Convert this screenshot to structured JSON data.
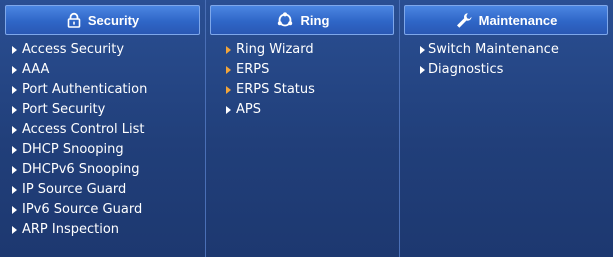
{
  "menu": {
    "security": {
      "title": "Security",
      "icon": "lock-icon",
      "items": [
        "Access Security",
        "AAA",
        "Port Authentication",
        "Port Security",
        "Access Control List",
        "DHCP Snooping",
        "DHCPv6 Snooping",
        "IP Source Guard",
        "IPv6 Source Guard",
        "ARP Inspection"
      ]
    },
    "ring": {
      "title": "Ring",
      "icon": "ring-icon",
      "items": [
        "Ring Wizard",
        "ERPS",
        "ERPS Status",
        "APS"
      ]
    },
    "maintenance": {
      "title": "Maintenance",
      "icon": "wrench-icon",
      "items": [
        "Switch Maintenance",
        "Diagnostics"
      ]
    }
  },
  "colors": {
    "panel": "#213f7a",
    "header": "#2f66c7",
    "text": "#ffffff",
    "ring_arrow": "#f2a53a"
  }
}
